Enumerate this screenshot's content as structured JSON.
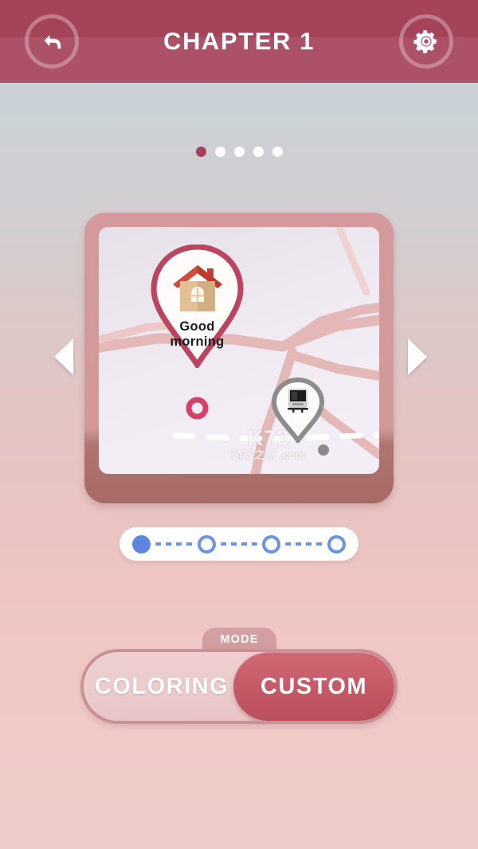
{
  "header": {
    "title": "CHAPTER 1",
    "back_icon": "back-arrow-icon",
    "settings_icon": "gear-icon"
  },
  "carousel": {
    "dots": [
      {
        "active": true
      },
      {
        "active": false
      },
      {
        "active": false
      },
      {
        "active": false
      },
      {
        "active": false
      }
    ],
    "dot_count": 5,
    "active_index": 0,
    "prev_arrow": "chevron-left-icon",
    "next_arrow": "chevron-right-icon"
  },
  "card": {
    "watermark": "K73",
    "watermark_sub": "游戏之家 .com",
    "pins": [
      {
        "id": "house-pin",
        "icon": "house-icon",
        "label_line1": "Good",
        "label_line2": "morning",
        "color": "#b9455f"
      },
      {
        "id": "train-pin",
        "icon": "train-icon",
        "label_line1": "",
        "label_line2": "",
        "color": "#8c8c8c"
      }
    ],
    "markers": [
      {
        "id": "ring-marker",
        "type": "ring",
        "color": "#d4426a"
      },
      {
        "id": "dot-marker",
        "type": "dot",
        "color": "#8a8a8a"
      }
    ]
  },
  "steps": {
    "nodes": [
      {
        "state": "filled"
      },
      {
        "state": "hollow"
      },
      {
        "state": "hollow"
      },
      {
        "state": "hollow"
      }
    ],
    "active_index": 0,
    "accent": "#5d87df"
  },
  "mode": {
    "tab_label": "MODE",
    "options": [
      {
        "label": "COLORING",
        "selected": false
      },
      {
        "label": "CUSTOM",
        "selected": true
      }
    ],
    "selected_index": 1,
    "selected_color": "#c65b68"
  },
  "theme": {
    "header_bg": "#a54458",
    "accent": "#a6415a",
    "card_frame": "#d1999a",
    "background_top": "#c5d2da",
    "background_bottom": "#eecac8"
  }
}
